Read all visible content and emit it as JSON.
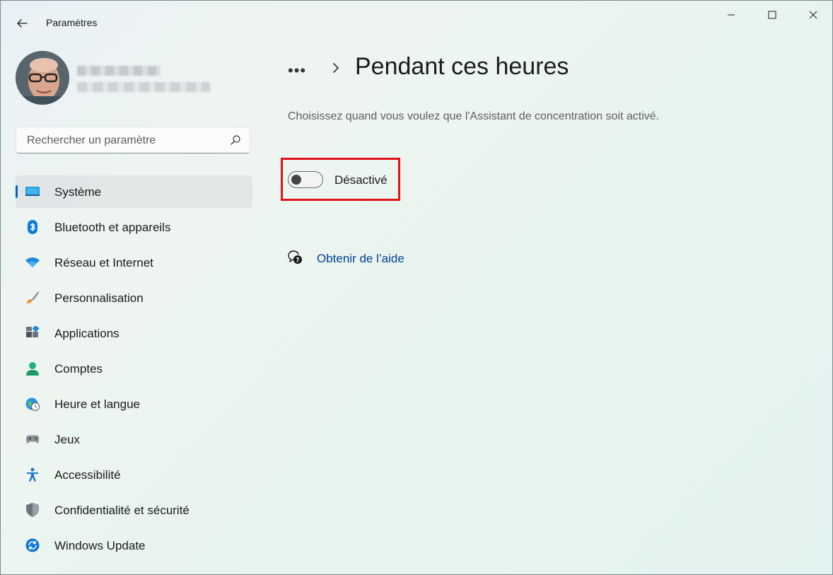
{
  "window": {
    "title": "Paramètres"
  },
  "search": {
    "placeholder": "Rechercher un paramètre"
  },
  "sidebar": {
    "items": [
      {
        "label": "Système",
        "icon": "system-display-icon",
        "selected": true
      },
      {
        "label": "Bluetooth et appareils",
        "icon": "bluetooth-icon"
      },
      {
        "label": "Réseau et Internet",
        "icon": "wifi-icon"
      },
      {
        "label": "Personnalisation",
        "icon": "paintbrush-icon"
      },
      {
        "label": "Applications",
        "icon": "apps-icon"
      },
      {
        "label": "Comptes",
        "icon": "person-icon"
      },
      {
        "label": "Heure et langue",
        "icon": "globe-clock-icon"
      },
      {
        "label": "Jeux",
        "icon": "gamepad-icon"
      },
      {
        "label": "Accessibilité",
        "icon": "accessibility-icon"
      },
      {
        "label": "Confidentialité et sécurité",
        "icon": "shield-icon"
      },
      {
        "label": "Windows Update",
        "icon": "update-icon"
      }
    ]
  },
  "main": {
    "breadcrumb_more": "•••",
    "title": "Pendant ces heures",
    "description": "Choisissez quand vous voulez que l'Assistant de concentration soit activé.",
    "toggle": {
      "label": "Désactivé",
      "state": false
    },
    "help_link": "Obtenir de l’aide"
  },
  "colors": {
    "accent": "#0067c0",
    "highlight": "#e2121b",
    "link": "#003e92"
  }
}
